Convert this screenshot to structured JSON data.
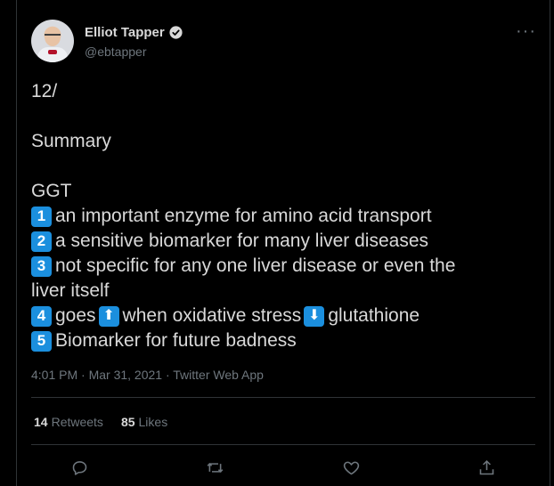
{
  "author": {
    "display_name": "Elliot Tapper",
    "handle": "@ebtapper"
  },
  "tweet": {
    "lines": [
      "12/",
      "",
      "Summary",
      "",
      "GGT"
    ],
    "list": [
      {
        "num": "1",
        "text": "an important enzyme for amino acid transport"
      },
      {
        "num": "2",
        "text": "a sensitive biomarker for many liver diseases"
      },
      {
        "num": "3",
        "text": "not specific for any one liver disease or even the"
      },
      {
        "num": "",
        "text": "liver itself"
      },
      {
        "num": "4",
        "text_a": "goes",
        "arrow_up": "⬆",
        "text_b": "when oxidative stress",
        "arrow_down": "⬇",
        "text_c": "glutathione"
      },
      {
        "num": "5",
        "text": "Biomarker for future badness"
      }
    ],
    "timestamp": "4:01 PM · Mar 31, 2021 · Twitter Web App"
  },
  "stats": {
    "retweets_count": "14",
    "retweets_label": "Retweets",
    "likes_count": "85",
    "likes_label": "Likes"
  },
  "icons": {
    "verified": "verified-icon",
    "more": "more-icon",
    "reply": "reply-icon",
    "retweet": "retweet-icon",
    "like": "like-icon",
    "share": "share-icon"
  },
  "colors": {
    "background": "#000000",
    "text": "#d9d9d9",
    "muted": "#6e767d",
    "border": "#2f3336",
    "keycap": "#1b8fde"
  }
}
